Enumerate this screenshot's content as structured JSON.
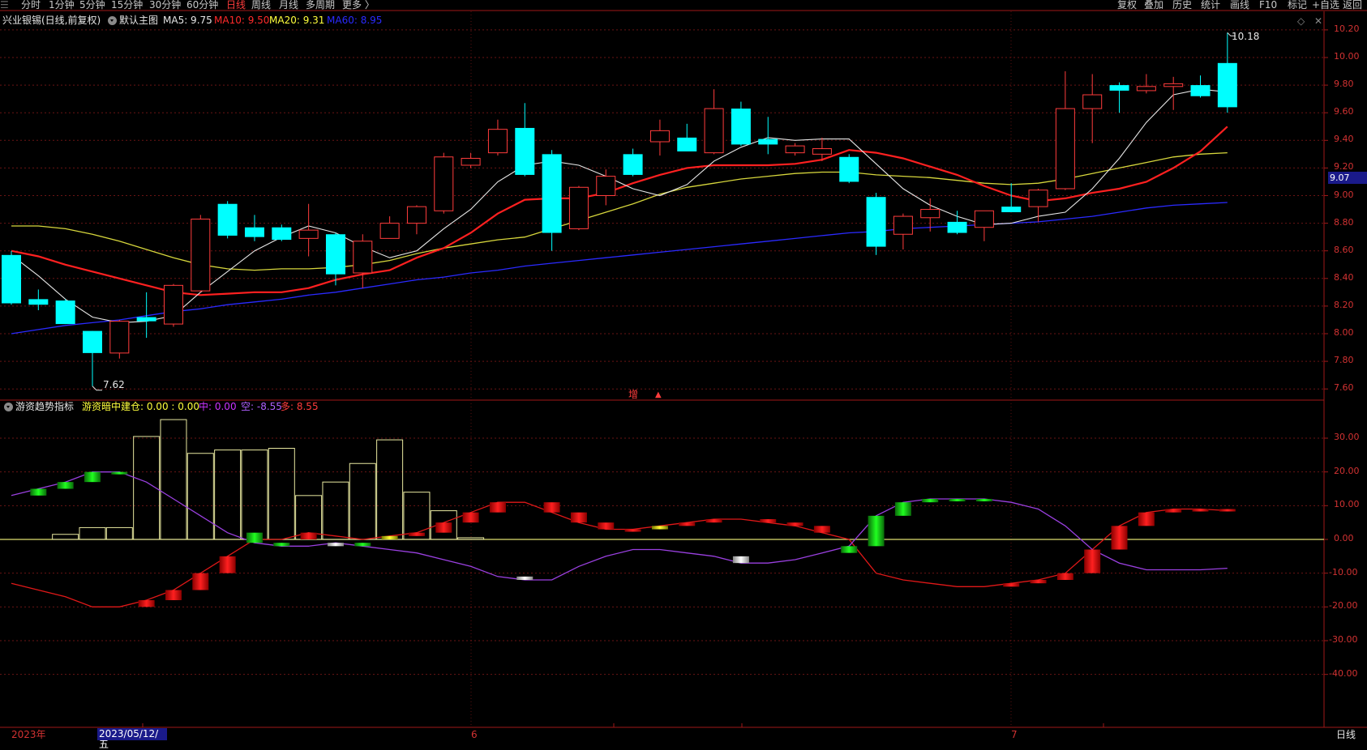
{
  "toolbar": {
    "left_items": [
      "分时",
      "1分钟",
      "5分钟",
      "15分钟",
      "30分钟",
      "60分钟",
      "日线",
      "周线",
      "月线",
      "多周期",
      "更多 〉"
    ],
    "active_item": "日线",
    "right_items": [
      "复权",
      "叠加",
      "历史",
      "统计",
      "画线",
      "F10",
      "标记",
      "+自选",
      "返回"
    ]
  },
  "main_panel": {
    "stock_name": "兴业银锡",
    "period_tag": "(日线,前复权)",
    "chart_name": "默认主图",
    "ma_labels": [
      {
        "text": "MA5: 9.75",
        "color": "#e6e6e6"
      },
      {
        "text": "MA10: 9.50",
        "color": "#ff2a2a"
      },
      {
        "text": "MA20: 9.31",
        "color": "#ffff3c"
      },
      {
        "text": "MA60: 8.95",
        "color": "#2a2aff"
      }
    ],
    "high_marker": "10.18",
    "low_marker": "7.62",
    "current_price": "9.07",
    "mid_marks": [
      "增",
      "▲"
    ]
  },
  "sub_panel": {
    "indicator_name": "游资趋势指标",
    "values": [
      {
        "text": "游资暗中建仓: 0.00 : 0.00",
        "color": "#ffff3c"
      },
      {
        "text": "中: 0.00",
        "color": "#cc33ff"
      },
      {
        "text": "空: -8.55",
        "color": "#b060ff"
      },
      {
        "text": "多: 8.55",
        "color": "#ff3c3c"
      }
    ]
  },
  "bottom_axis": {
    "year_label": "2023年",
    "cursor_date": "2023/05/12/五",
    "month_labels": [
      "6",
      "7"
    ],
    "period_label": "日线"
  },
  "chart_data": [
    {
      "type": "candlestick",
      "ylim": [
        7.5,
        10.3
      ],
      "y_ticks": [
        "10.20",
        "10.00",
        "9.80",
        "9.60",
        "9.40",
        "9.20",
        "9.00",
        "8.80",
        "8.60",
        "8.40",
        "8.20",
        "8.00",
        "7.80",
        "7.60"
      ],
      "candles": [
        [
          8.57,
          8.6,
          8.21,
          8.22
        ],
        [
          8.25,
          8.32,
          8.17,
          8.21
        ],
        [
          8.24,
          8.25,
          8.07,
          8.07
        ],
        [
          8.02,
          8.02,
          7.62,
          7.86
        ],
        [
          7.86,
          8.1,
          7.82,
          8.09
        ],
        [
          8.12,
          8.3,
          7.97,
          8.09
        ],
        [
          8.07,
          8.36,
          8.05,
          8.35
        ],
        [
          8.31,
          8.86,
          8.3,
          8.83
        ],
        [
          8.94,
          8.96,
          8.69,
          8.71
        ],
        [
          8.77,
          8.86,
          8.67,
          8.7
        ],
        [
          8.77,
          8.79,
          8.67,
          8.68
        ],
        [
          8.69,
          8.94,
          8.56,
          8.75
        ],
        [
          8.72,
          8.73,
          8.35,
          8.43
        ],
        [
          8.44,
          8.72,
          8.33,
          8.67
        ],
        [
          8.69,
          8.85,
          8.69,
          8.8
        ],
        [
          8.8,
          8.93,
          8.72,
          8.92
        ],
        [
          8.89,
          9.31,
          8.87,
          9.28
        ],
        [
          9.22,
          9.31,
          9.2,
          9.27
        ],
        [
          9.31,
          9.55,
          9.29,
          9.48
        ],
        [
          9.49,
          9.67,
          9.14,
          9.15
        ],
        [
          9.3,
          9.33,
          8.6,
          8.73
        ],
        [
          8.76,
          9.07,
          8.75,
          9.06
        ],
        [
          9.0,
          9.19,
          8.93,
          9.14
        ],
        [
          9.3,
          9.34,
          9.14,
          9.15
        ],
        [
          9.39,
          9.55,
          9.29,
          9.47
        ],
        [
          9.42,
          9.52,
          9.33,
          9.32
        ],
        [
          9.31,
          9.77,
          9.3,
          9.63
        ],
        [
          9.63,
          9.68,
          9.36,
          9.37
        ],
        [
          9.41,
          9.57,
          9.3,
          9.37
        ],
        [
          9.31,
          9.38,
          9.29,
          9.36
        ],
        [
          9.3,
          9.42,
          9.25,
          9.34
        ],
        [
          9.28,
          9.3,
          9.09,
          9.1
        ],
        [
          8.99,
          9.02,
          8.57,
          8.63
        ],
        [
          8.72,
          8.87,
          8.61,
          8.85
        ],
        [
          8.84,
          8.98,
          8.74,
          8.9
        ],
        [
          8.81,
          8.89,
          8.72,
          8.73
        ],
        [
          8.77,
          8.88,
          8.67,
          8.89
        ],
        [
          8.92,
          9.09,
          8.89,
          8.88
        ],
        [
          8.92,
          9.05,
          8.81,
          9.04
        ],
        [
          9.05,
          9.9,
          9.04,
          9.63
        ],
        [
          9.63,
          9.88,
          9.38,
          9.73
        ],
        [
          9.8,
          9.82,
          9.6,
          9.76
        ],
        [
          9.76,
          9.88,
          9.74,
          9.79
        ],
        [
          9.79,
          9.86,
          9.62,
          9.81
        ],
        [
          9.8,
          9.87,
          9.71,
          9.72
        ],
        [
          9.96,
          10.18,
          9.6,
          9.64
        ]
      ],
      "ma5": [
        8.57,
        8.42,
        8.25,
        8.12,
        8.08,
        8.09,
        8.13,
        8.3,
        8.45,
        8.6,
        8.7,
        8.78,
        8.73,
        8.63,
        8.55,
        8.6,
        8.76,
        8.9,
        9.1,
        9.22,
        9.25,
        9.22,
        9.14,
        9.05,
        9.0,
        9.08,
        9.25,
        9.35,
        9.42,
        9.4,
        9.41,
        9.41,
        9.23,
        9.05,
        8.93,
        8.85,
        8.79,
        8.8,
        8.85,
        8.88,
        9.05,
        9.27,
        9.53,
        9.73,
        9.77,
        9.75
      ],
      "ma10": [
        8.6,
        8.56,
        8.5,
        8.45,
        8.4,
        8.35,
        8.3,
        8.28,
        8.29,
        8.3,
        8.3,
        8.33,
        8.39,
        8.43,
        8.46,
        8.55,
        8.62,
        8.73,
        8.87,
        8.97,
        8.98,
        8.98,
        9.02,
        9.09,
        9.15,
        9.2,
        9.22,
        9.22,
        9.22,
        9.23,
        9.26,
        9.33,
        9.31,
        9.27,
        9.21,
        9.15,
        9.07,
        9.0,
        8.96,
        8.98,
        9.02,
        9.05,
        9.1,
        9.2,
        9.32,
        9.5
      ],
      "ma20": [
        8.78,
        8.78,
        8.76,
        8.72,
        8.67,
        8.61,
        8.55,
        8.5,
        8.47,
        8.46,
        8.47,
        8.47,
        8.48,
        8.5,
        8.53,
        8.58,
        8.62,
        8.65,
        8.68,
        8.7,
        8.76,
        8.82,
        8.88,
        8.94,
        9.01,
        9.06,
        9.09,
        9.12,
        9.14,
        9.16,
        9.17,
        9.17,
        9.15,
        9.14,
        9.13,
        9.11,
        9.09,
        9.08,
        9.09,
        9.12,
        9.16,
        9.2,
        9.24,
        9.28,
        9.3,
        9.31
      ],
      "ma60": [
        8.0,
        8.03,
        8.06,
        8.08,
        8.1,
        8.13,
        8.16,
        8.18,
        8.21,
        8.23,
        8.25,
        8.28,
        8.3,
        8.33,
        8.36,
        8.39,
        8.41,
        8.44,
        8.46,
        8.49,
        8.51,
        8.53,
        8.55,
        8.57,
        8.59,
        8.61,
        8.63,
        8.65,
        8.67,
        8.69,
        8.71,
        8.73,
        8.74,
        8.76,
        8.77,
        8.78,
        8.79,
        8.8,
        8.81,
        8.83,
        8.85,
        8.88,
        8.91,
        8.93,
        8.94,
        8.95
      ]
    },
    {
      "type": "bar",
      "ylim": [
        -57,
        40
      ],
      "y_ticks": [
        "30.00",
        "20.00",
        "10.00",
        "0.00",
        "-10.00",
        "-20.00",
        "-30.00",
        "-40.00"
      ],
      "duo": [
        -13,
        -15,
        -17,
        -20,
        -20,
        -18,
        -15,
        -10,
        -5,
        0,
        0,
        2,
        1,
        0,
        1,
        2,
        5,
        8,
        11,
        11,
        8,
        5,
        3,
        3,
        4,
        5,
        6,
        6,
        5,
        4,
        2,
        0,
        -10,
        -12,
        -13,
        -14,
        -14,
        -13,
        -12,
        -10,
        -3,
        4,
        8,
        9,
        9,
        8.55
      ],
      "kong": [
        13,
        15,
        17,
        20,
        20,
        17,
        12,
        7,
        2,
        -1,
        -2,
        -2,
        -1,
        -2,
        -3,
        -4,
        -6,
        -8,
        -11,
        -12,
        -12,
        -8,
        -5,
        -3,
        -3,
        -4,
        -5,
        -7,
        -7,
        -6,
        -4,
        -2,
        7,
        11,
        12,
        12,
        12,
        11,
        9,
        4,
        -3,
        -7,
        -9,
        -9,
        -9,
        -8.55
      ],
      "gray_markers": [
        12,
        19,
        27
      ],
      "jiancang": [
        0,
        0,
        1.5,
        3.5,
        3.5,
        30.5,
        35.5,
        25.5,
        26.5,
        26.5,
        27,
        13,
        17,
        22.5,
        29.5,
        14,
        8.5,
        0.5,
        0,
        0,
        0,
        0,
        0,
        0,
        0,
        0,
        0,
        0,
        0,
        0,
        0,
        0,
        0,
        0,
        0,
        0,
        0,
        0,
        0,
        0,
        0,
        0,
        0,
        0,
        0,
        0
      ],
      "gold_bars": [
        14,
        24
      ]
    }
  ]
}
